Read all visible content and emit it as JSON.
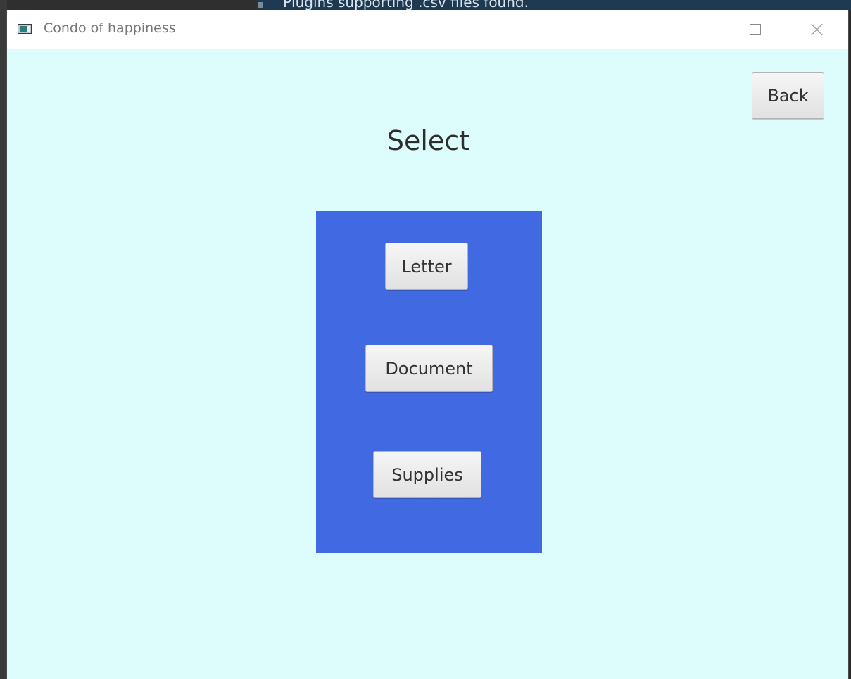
{
  "background_window": {
    "text": "Plugins supporting .csv files found."
  },
  "window": {
    "title": "Condo of happiness",
    "icon": "app-window-icon",
    "controls": [
      "minimize-icon",
      "maximize-icon",
      "close-icon"
    ]
  },
  "header": {
    "back_label": "Back",
    "heading": "Select"
  },
  "panel": {
    "color": "#4169e1",
    "buttons": {
      "letter": "Letter",
      "document": "Document",
      "supplies": "Supplies"
    }
  },
  "colors": {
    "window_background": "#ddfdfd",
    "panel": "#4169e1"
  }
}
